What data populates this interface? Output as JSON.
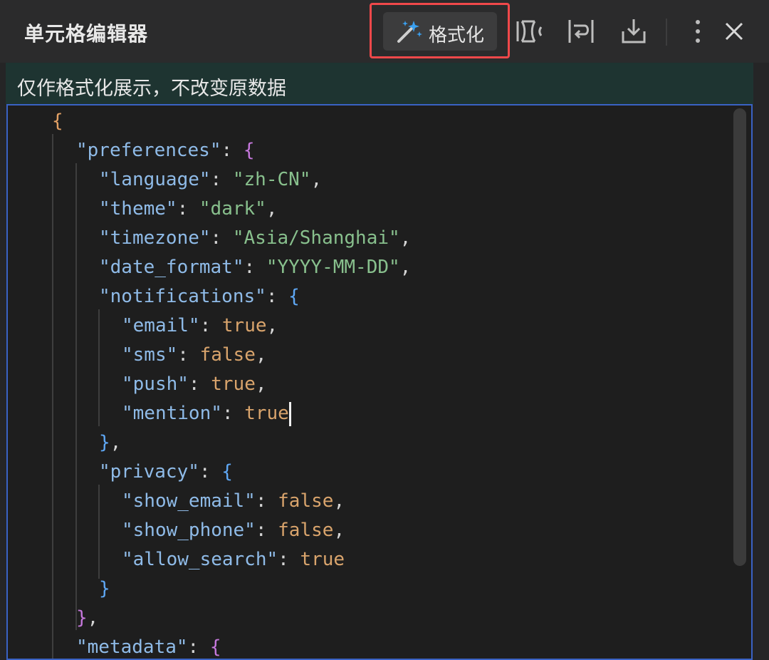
{
  "panel": {
    "title": "单元格编辑器"
  },
  "toolbar": {
    "format_label": "格式化",
    "icons": [
      "sparkle-wand-icon",
      "compress-icon",
      "wrap-icon",
      "download-icon",
      "more-vertical-icon",
      "close-icon"
    ]
  },
  "hint": {
    "text": "仅作格式化展示，不改变原数据"
  },
  "editor": {
    "lines": [
      {
        "parts": [
          {
            "t": "{",
            "c": "brace-o"
          }
        ]
      },
      {
        "parts": [
          {
            "t": "\"preferences\"",
            "c": "k"
          },
          {
            "t": ": ",
            "c": "p"
          },
          {
            "t": "{",
            "c": "brace-m"
          }
        ]
      },
      {
        "parts": [
          {
            "t": "\"language\"",
            "c": "k"
          },
          {
            "t": ": ",
            "c": "p"
          },
          {
            "t": "\"zh-CN\"",
            "c": "s"
          },
          {
            "t": ",",
            "c": "p"
          }
        ]
      },
      {
        "parts": [
          {
            "t": "\"theme\"",
            "c": "k"
          },
          {
            "t": ": ",
            "c": "p"
          },
          {
            "t": "\"dark\"",
            "c": "s"
          },
          {
            "t": ",",
            "c": "p"
          }
        ]
      },
      {
        "parts": [
          {
            "t": "\"timezone\"",
            "c": "k"
          },
          {
            "t": ": ",
            "c": "p"
          },
          {
            "t": "\"Asia/Shanghai\"",
            "c": "s"
          },
          {
            "t": ",",
            "c": "p"
          }
        ]
      },
      {
        "parts": [
          {
            "t": "\"date_format\"",
            "c": "k"
          },
          {
            "t": ": ",
            "c": "p"
          },
          {
            "t": "\"YYYY-MM-DD\"",
            "c": "s"
          },
          {
            "t": ",",
            "c": "p"
          }
        ]
      },
      {
        "parts": [
          {
            "t": "\"notifications\"",
            "c": "k"
          },
          {
            "t": ": ",
            "c": "p"
          },
          {
            "t": "{",
            "c": "brace-b"
          }
        ]
      },
      {
        "parts": [
          {
            "t": "\"email\"",
            "c": "k"
          },
          {
            "t": ": ",
            "c": "p"
          },
          {
            "t": "true",
            "c": "b"
          },
          {
            "t": ",",
            "c": "p"
          }
        ]
      },
      {
        "parts": [
          {
            "t": "\"sms\"",
            "c": "k"
          },
          {
            "t": ": ",
            "c": "p"
          },
          {
            "t": "false",
            "c": "b"
          },
          {
            "t": ",",
            "c": "p"
          }
        ]
      },
      {
        "parts": [
          {
            "t": "\"push\"",
            "c": "k"
          },
          {
            "t": ": ",
            "c": "p"
          },
          {
            "t": "true",
            "c": "b"
          },
          {
            "t": ",",
            "c": "p"
          }
        ]
      },
      {
        "parts": [
          {
            "t": "\"mention\"",
            "c": "k"
          },
          {
            "t": ": ",
            "c": "p"
          },
          {
            "t": "true",
            "c": "b"
          }
        ],
        "cursor": true
      },
      {
        "parts": [
          {
            "t": "}",
            "c": "brace-b"
          },
          {
            "t": ",",
            "c": "p"
          }
        ]
      },
      {
        "parts": [
          {
            "t": "\"privacy\"",
            "c": "k"
          },
          {
            "t": ": ",
            "c": "p"
          },
          {
            "t": "{",
            "c": "brace-b"
          }
        ]
      },
      {
        "parts": [
          {
            "t": "\"show_email\"",
            "c": "k"
          },
          {
            "t": ": ",
            "c": "p"
          },
          {
            "t": "false",
            "c": "b"
          },
          {
            "t": ",",
            "c": "p"
          }
        ]
      },
      {
        "parts": [
          {
            "t": "\"show_phone\"",
            "c": "k"
          },
          {
            "t": ": ",
            "c": "p"
          },
          {
            "t": "false",
            "c": "b"
          },
          {
            "t": ",",
            "c": "p"
          }
        ]
      },
      {
        "parts": [
          {
            "t": "\"allow_search\"",
            "c": "k"
          },
          {
            "t": ": ",
            "c": "p"
          },
          {
            "t": "true",
            "c": "b"
          }
        ]
      },
      {
        "parts": [
          {
            "t": "}",
            "c": "brace-b"
          }
        ]
      },
      {
        "parts": [
          {
            "t": "}",
            "c": "brace-m"
          },
          {
            "t": ",",
            "c": "p"
          }
        ]
      },
      {
        "parts": [
          {
            "t": "\"metadata\"",
            "c": "k"
          },
          {
            "t": ": ",
            "c": "p"
          },
          {
            "t": "{",
            "c": "brace-m"
          }
        ]
      }
    ]
  }
}
